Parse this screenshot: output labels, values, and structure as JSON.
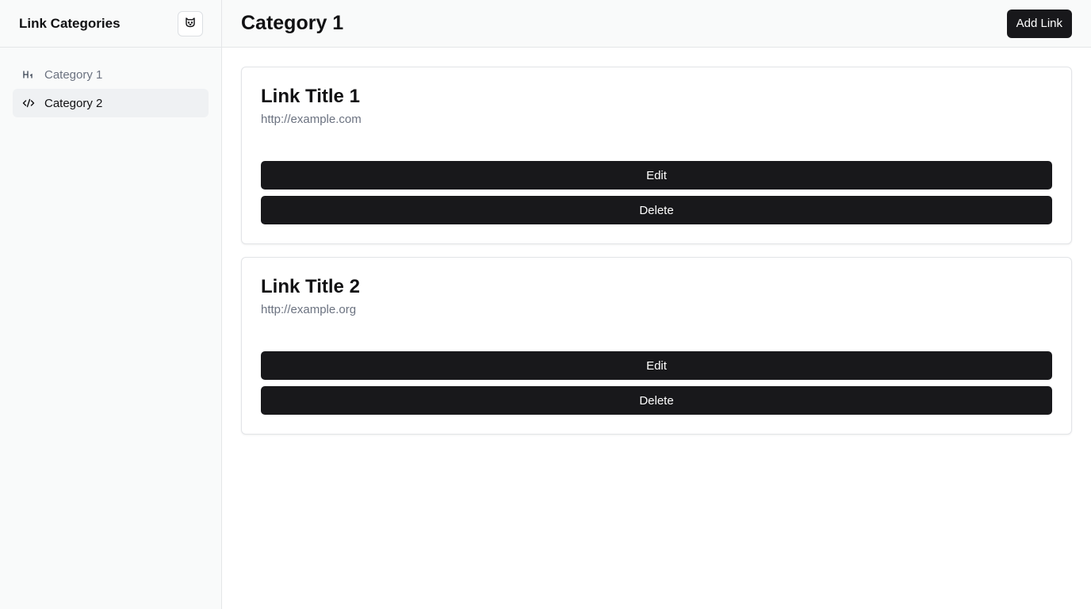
{
  "sidebar": {
    "title": "Link Categories",
    "toggle_icon": "cat-face-icon",
    "items": [
      {
        "label": "Category 1",
        "icon": "heading-icon",
        "icon_text": "H1",
        "active": false
      },
      {
        "label": "Category 2",
        "icon": "code-icon",
        "icon_text": "</>",
        "active": true
      }
    ]
  },
  "header": {
    "title": "Category 1",
    "add_label": "Add Link"
  },
  "links": [
    {
      "title": "Link Title 1",
      "url": "http://example.com",
      "edit_label": "Edit",
      "delete_label": "Delete"
    },
    {
      "title": "Link Title 2",
      "url": "http://example.org",
      "edit_label": "Edit",
      "delete_label": "Delete"
    }
  ],
  "colors": {
    "primary": "#18181b",
    "sidebar_bg": "#f9fafa",
    "muted_text": "#6b7280",
    "active_bg": "#eff1f3"
  }
}
